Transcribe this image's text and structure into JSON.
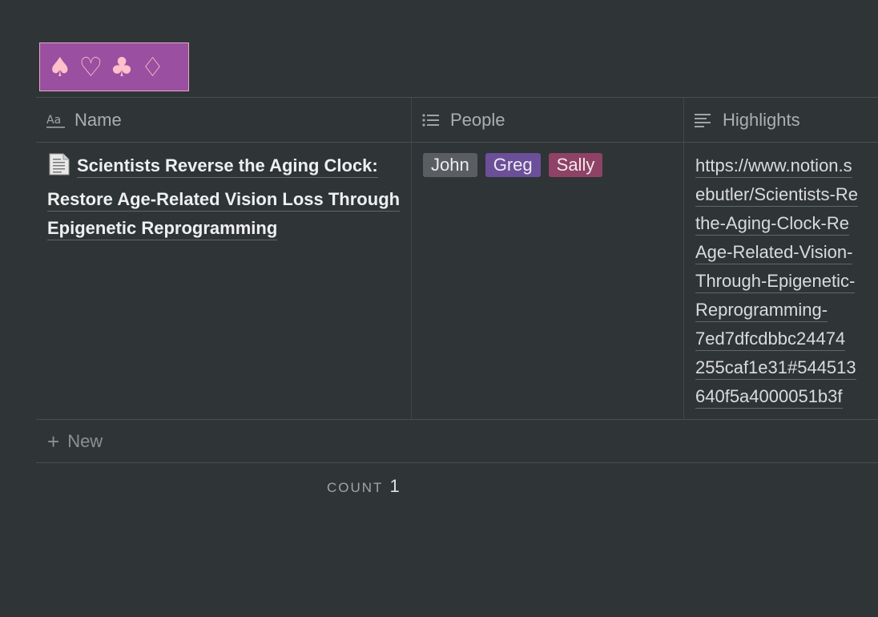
{
  "banner": {
    "suits": [
      "♠",
      "♡",
      "♣",
      "♢"
    ],
    "background": "#9a4fa0",
    "suit_color": "#ffc0cb"
  },
  "table": {
    "columns": [
      {
        "label": "Name",
        "icon": "text-aa-icon"
      },
      {
        "label": "People",
        "icon": "list-icon"
      },
      {
        "label": "Highlights",
        "icon": "text-lines-icon"
      }
    ],
    "rows": [
      {
        "title": "Scientists Reverse the Aging Clock: Restore Age-Related Vision Loss Through Epigenetic Reprogramming",
        "page_icon": "page-document-icon",
        "people": [
          {
            "name": "John",
            "color": "#5a5e63"
          },
          {
            "name": "Greg",
            "color": "#6c4f99"
          },
          {
            "name": "Sally",
            "color": "#8e4266"
          }
        ],
        "highlights_lines": [
          "https://www.notion.s",
          "ebutler/Scientists-Re",
          "the-Aging-Clock-Re",
          "Age-Related-Vision-",
          "Through-Epigenetic-",
          "Reprogramming-",
          "7ed7dfcdbbc24474",
          "255caf1e31#544513",
          "640f5a4000051b3f"
        ]
      }
    ],
    "new_label": "New",
    "count_label": "COUNT",
    "count_value": "1"
  }
}
